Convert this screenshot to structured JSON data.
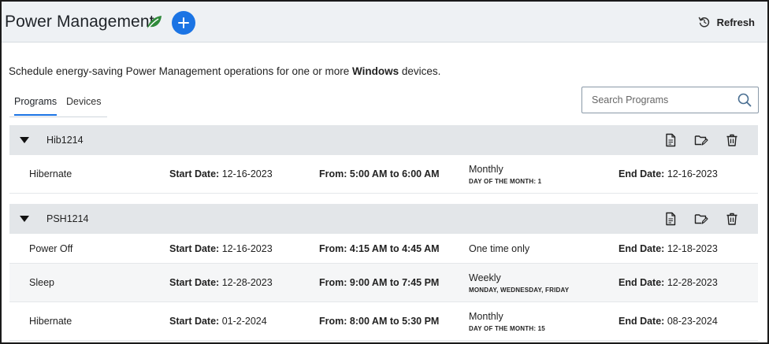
{
  "header": {
    "title": "Power Management",
    "refresh_label": "Refresh"
  },
  "description": {
    "prefix": "Schedule energy-saving Power Management operations for one or more ",
    "bold": "Windows",
    "suffix": " devices."
  },
  "tabs": [
    {
      "label": "Programs",
      "active": true
    },
    {
      "label": "Devices",
      "active": false
    }
  ],
  "search": {
    "placeholder": "Search Programs",
    "value": ""
  },
  "colors": {
    "accent": "#1b74e4",
    "leaf": "#2f8a3a"
  },
  "groups": [
    {
      "name": "Hib1214",
      "programs": [
        {
          "action": "Hibernate",
          "start_label": "Start Date:",
          "start_value": "12-16-2023",
          "time": "From: 5:00 AM to 6:00 AM",
          "frequency": "Monthly",
          "frequency_detail": "DAY OF THE MONTH: 1",
          "end_label": "End Date:",
          "end_value": "12-16-2023"
        }
      ]
    },
    {
      "name": "PSH1214",
      "programs": [
        {
          "action": "Power Off",
          "start_label": "Start Date:",
          "start_value": "12-16-2023",
          "time": "From: 4:15 AM to 4:45 AM",
          "frequency": "One time only",
          "frequency_detail": "",
          "end_label": "End Date:",
          "end_value": "12-18-2023"
        },
        {
          "action": "Sleep",
          "start_label": "Start Date:",
          "start_value": "12-28-2023",
          "time": "From: 9:00 AM to 7:45 PM",
          "frequency": "Weekly",
          "frequency_detail": "MONDAY, WEDNESDAY, FRIDAY",
          "end_label": "End Date:",
          "end_value": "12-28-2023"
        },
        {
          "action": "Hibernate",
          "start_label": "Start Date:",
          "start_value": "01-2-2024",
          "time": "From: 8:00 AM to 5:30 PM",
          "frequency": "Monthly",
          "frequency_detail": "DAY OF THE MONTH: 15",
          "end_label": "End Date:",
          "end_value": "08-23-2024"
        }
      ]
    }
  ]
}
